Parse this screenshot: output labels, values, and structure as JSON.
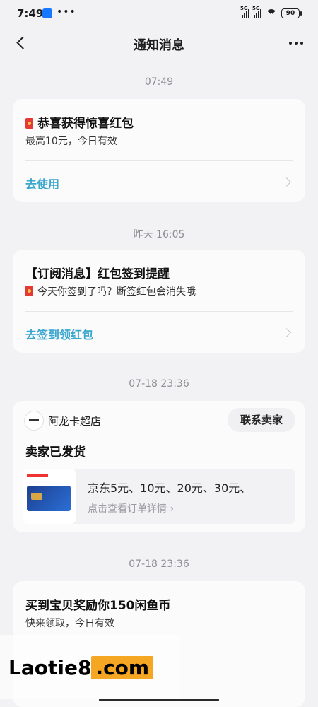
{
  "status_bar": {
    "time": "7:49",
    "battery": "90",
    "net1": "5G",
    "net2": "5G"
  },
  "nav": {
    "title": "通知消息"
  },
  "messages": [
    {
      "time": "07:49",
      "title": "恭喜获得惊喜红包",
      "subtitle": "最高10元，今日有效",
      "action": "去使用"
    },
    {
      "time": "昨天 16:05",
      "title": "【订阅消息】红包签到提醒",
      "subtitle": "今天你签到了吗？断签红包会消失哦",
      "action": "去签到领红包"
    },
    {
      "time": "07-18 23:36",
      "shop": "阿龙卡超店",
      "contact": "联系卖家",
      "title": "卖家已发货",
      "order_title": "京东5元、10元、20元、30元、",
      "order_link": "点击查看订单详情 ›"
    },
    {
      "time": "07-18 23:36",
      "title": "买到宝贝奖励你150闲鱼币",
      "subtitle": "快来领取，今日有效"
    }
  ],
  "watermark": {
    "prefix": "Laotie8",
    "suffix": ".com"
  }
}
